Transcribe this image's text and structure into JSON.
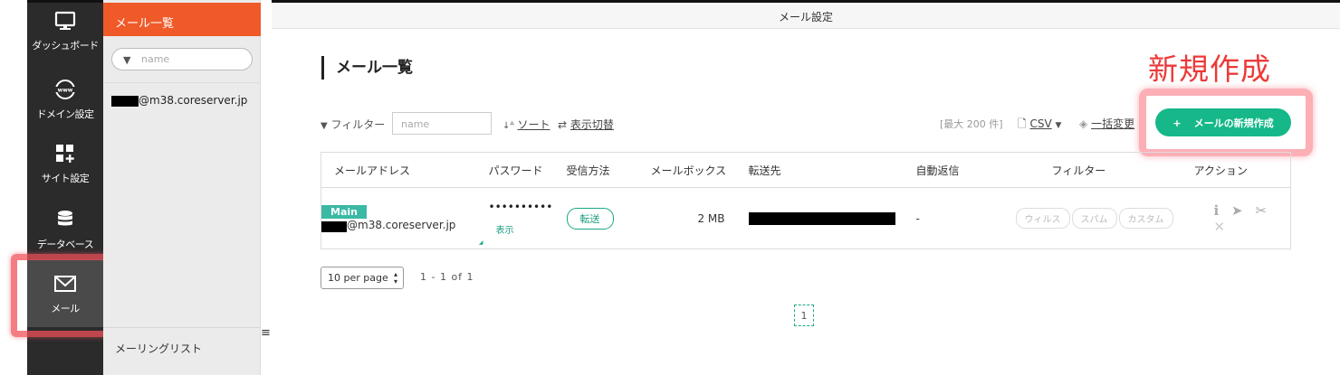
{
  "nav": {
    "items": [
      {
        "label": "ダッシュボード",
        "icon": "monitor-icon"
      },
      {
        "label": "ドメイン設定",
        "icon": "www-globe-icon"
      },
      {
        "label": "サイト設定",
        "icon": "grid-plus-icon"
      },
      {
        "label": "データベース",
        "icon": "database-icon"
      },
      {
        "label": "メール",
        "icon": "envelope-icon"
      }
    ],
    "active": "メール"
  },
  "sidebar": {
    "header": "メール一覧",
    "search_placeholder": "name",
    "entries": [
      "@m38.coreserver.jp"
    ],
    "bottom_item": "メーリングリスト"
  },
  "topbar": {
    "title": "メール設定"
  },
  "page": {
    "title": "メール一覧"
  },
  "toolbar": {
    "filter_label": "フィルター",
    "filter_placeholder": "name",
    "sort_label": "ソート",
    "toggle_label": "表示切替",
    "max_label": "[最大 200 件]",
    "csv_label": "CSV",
    "bulk_label": "一括変更"
  },
  "annotation": "新規作成",
  "new_button": "メールの新規作成",
  "table": {
    "headers": [
      "メールアドレス",
      "パスワード",
      "受信方法",
      "メールボックス",
      "転送先",
      "自動返信",
      "フィルター",
      "アクション"
    ],
    "rows": [
      {
        "tag": "Main",
        "email": "@m38.coreserver.jp",
        "password": "••••••••••",
        "show_label": "表示",
        "method": "転送",
        "mailbox": "2 MB",
        "autoreply": "-",
        "filters": [
          "ウィルス",
          "スパム",
          "カスタム"
        ]
      }
    ]
  },
  "pagination": {
    "per_page": "10 per page",
    "range": "1 - 1 of 1",
    "current_page": "1"
  },
  "colors": {
    "accent": "#16b889",
    "orange": "#f05a28",
    "annotation_red": "#ec3a3a"
  }
}
